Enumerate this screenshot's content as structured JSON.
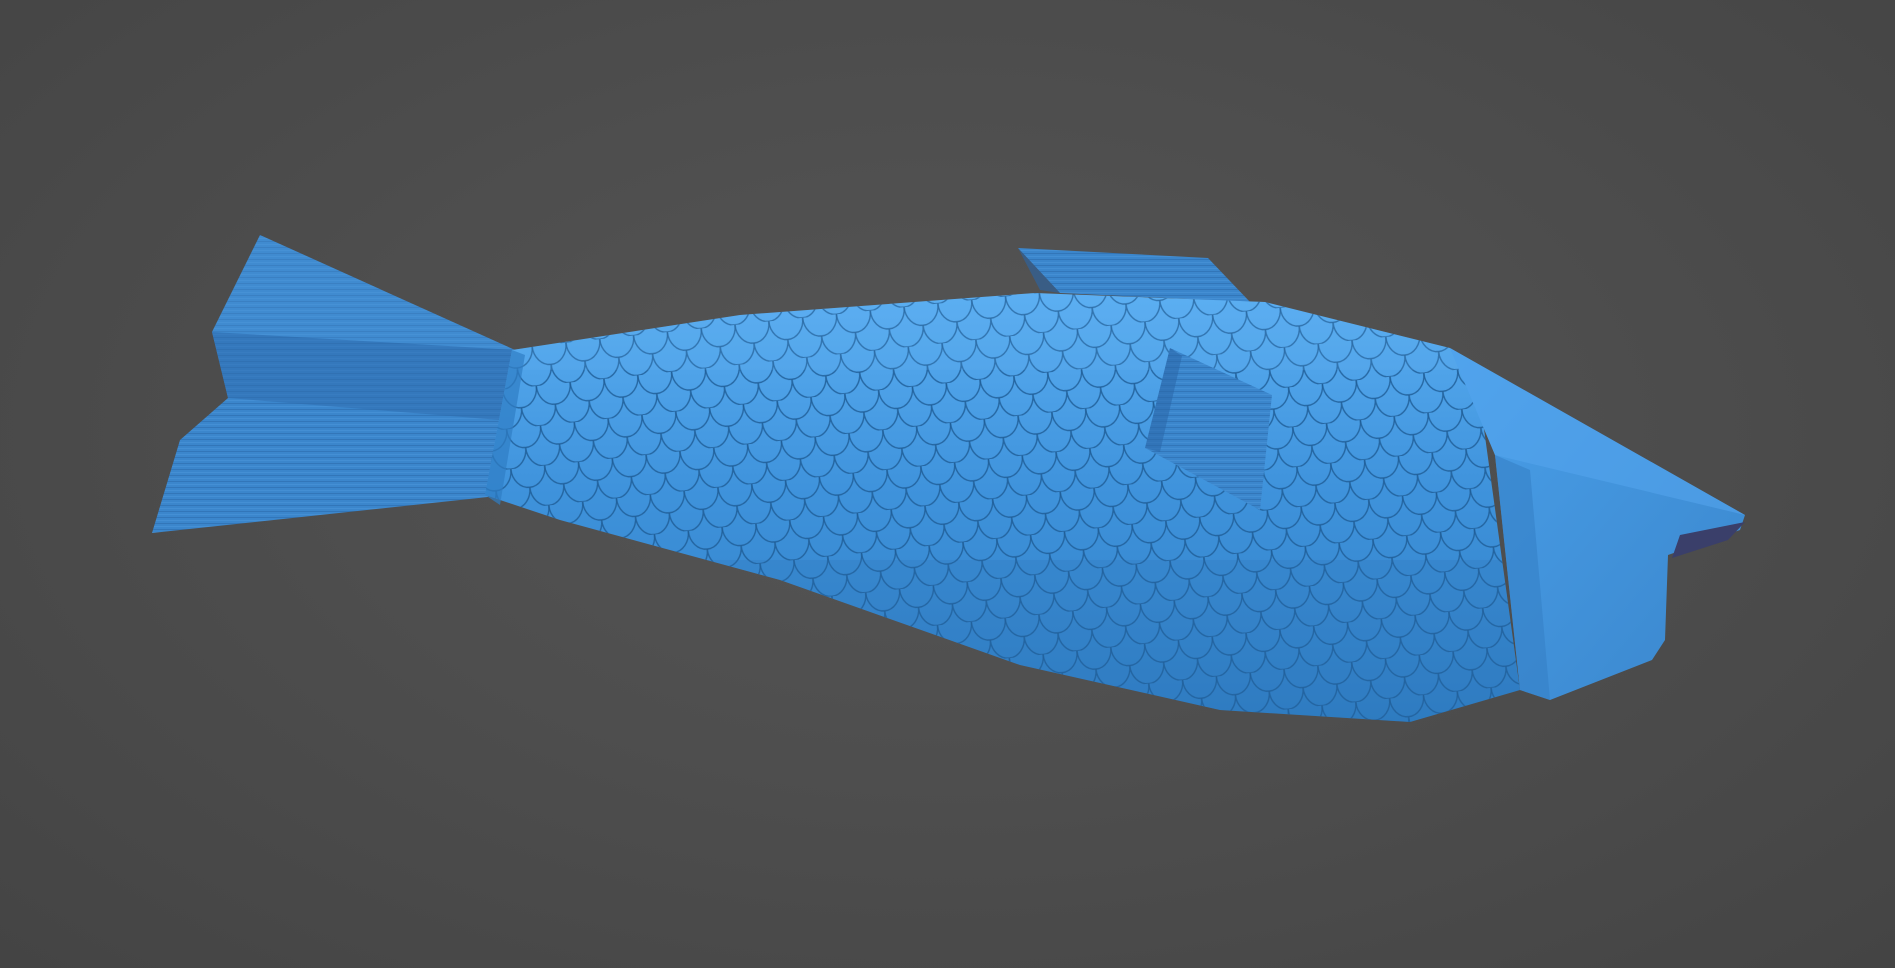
{
  "viewport": {
    "background_color": "#4e4e4e"
  },
  "model": {
    "object": "fish",
    "colors": {
      "body": "#3d8fd8",
      "body_light": "#5aa8ee",
      "body_dark": "#2a6fb0",
      "scale_line": "#1f5d96",
      "fin": "#3b86cc",
      "fin_dark": "#2a66a8",
      "mouth": "#3a3f6a"
    },
    "parts": [
      "tail-fin-icon",
      "body-scales",
      "dorsal-fin-icon",
      "pectoral-fin-icon",
      "head-cone",
      "mouth"
    ]
  }
}
